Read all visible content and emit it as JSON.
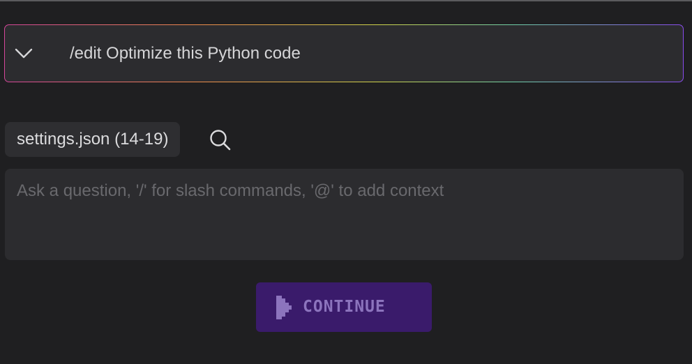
{
  "command": {
    "text": "/edit Optimize this Python code",
    "toggle_icon": "chevron-down-icon",
    "border_gradient": [
      "#d5469a",
      "#ee8a4c",
      "#cfd34a",
      "#6fd0a8",
      "#8a4cf0"
    ]
  },
  "context": {
    "chip_label": "settings.json (14-19)",
    "search_icon": "search-icon"
  },
  "input": {
    "placeholder": "Ask a question, '/' for slash commands, '@' to add context",
    "value": ""
  },
  "continue_button": {
    "label": "CONTINUE",
    "icon": "play-icon",
    "background": "#3a1b6b",
    "text_color": "#8c74bd"
  }
}
